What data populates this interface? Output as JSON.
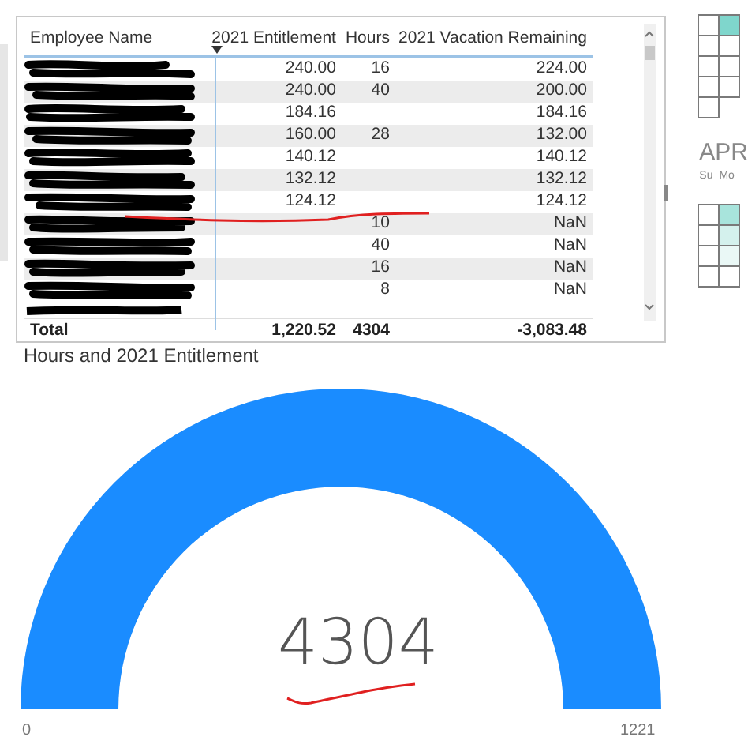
{
  "table": {
    "columns": [
      {
        "label": "Employee Name",
        "sorted": false
      },
      {
        "label": "2021 Entitlement",
        "sorted": true
      },
      {
        "label": "Hours",
        "sorted": false
      },
      {
        "label": "2021 Vacation Remaining",
        "sorted": false
      }
    ],
    "rows": [
      {
        "entitlement": "240.00",
        "hours": "16",
        "remaining": "224.00"
      },
      {
        "entitlement": "240.00",
        "hours": "40",
        "remaining": "200.00"
      },
      {
        "entitlement": "184.16",
        "remaining": "184.16"
      },
      {
        "entitlement": "160.00",
        "hours": "28",
        "remaining": "132.00"
      },
      {
        "entitlement": "140.12",
        "remaining": "140.12"
      },
      {
        "entitlement": "132.12",
        "remaining": "132.12"
      },
      {
        "entitlement": "124.12",
        "remaining": "124.12"
      },
      {
        "hours": "10",
        "remaining": "NaN"
      },
      {
        "hours": "40",
        "remaining": "NaN"
      },
      {
        "hours": "16",
        "remaining": "NaN"
      },
      {
        "hours": "8",
        "remaining": "NaN"
      }
    ],
    "total": {
      "label": "Total",
      "entitlement": "1,220.52",
      "hours": "4304",
      "remaining": "-3,083.48"
    }
  },
  "gauge": {
    "title": "Hours and 2021 Entitlement",
    "value": "4304",
    "min": "0",
    "max": "1221",
    "level": 1
  },
  "calendar": {
    "top_grid": [
      [
        {
          "color": "#ffffff"
        },
        {
          "color": "#7fd6cc"
        }
      ],
      [
        {
          "color": "#ffffff"
        },
        {
          "color": "#ffffff"
        }
      ],
      [
        {
          "color": "#ffffff"
        },
        {
          "color": "#ffffff"
        }
      ],
      [
        {
          "color": "#ffffff"
        },
        {
          "color": "#ffffff"
        }
      ],
      [
        {
          "color": "#ffffff"
        }
      ]
    ],
    "month": "APR",
    "weekdays": [
      "Su",
      "Mo"
    ],
    "bottom_grid": [
      [
        {
          "color": "#ffffff"
        },
        {
          "color": "#a8e4dc"
        }
      ],
      [
        {
          "color": "#ffffff"
        },
        {
          "color": "#d4f1ed"
        }
      ],
      [
        {
          "color": "#ffffff"
        },
        {
          "color": "#eaf8f6"
        }
      ],
      [
        {
          "color": "#ffffff"
        },
        {
          "color": "#ffffff"
        }
      ]
    ]
  }
}
